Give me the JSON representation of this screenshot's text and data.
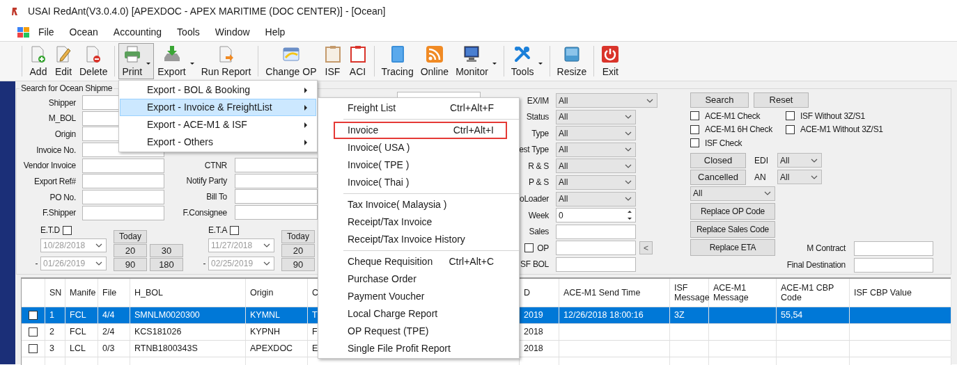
{
  "window": {
    "title": "USAI RedAnt(V3.0.4.0) [APEXDOC - APEX MARITIME (DOC CENTER)] - [Ocean]"
  },
  "menu_bar": [
    "File",
    "Ocean",
    "Accounting",
    "Tools",
    "Window",
    "Help"
  ],
  "toolbar": [
    [
      {
        "label": "Add",
        "dropdown": false,
        "pressed": false
      },
      {
        "label": "Edit",
        "dropdown": false,
        "pressed": false
      },
      {
        "label": "Delete",
        "dropdown": false,
        "pressed": false
      }
    ],
    [
      {
        "label": "Print",
        "dropdown": true,
        "pressed": true
      },
      {
        "label": "Export",
        "dropdown": true,
        "pressed": false
      },
      {
        "label": "Run Report",
        "dropdown": false,
        "pressed": false
      }
    ],
    [
      {
        "label": "Change OP",
        "dropdown": false,
        "pressed": false
      },
      {
        "label": "ISF",
        "dropdown": false,
        "pressed": false
      },
      {
        "label": "ACI",
        "dropdown": false,
        "pressed": false
      }
    ],
    [
      {
        "label": "Tracing",
        "dropdown": false,
        "pressed": false
      },
      {
        "label": "Online",
        "dropdown": false,
        "pressed": false
      },
      {
        "label": "Monitor",
        "dropdown": true,
        "pressed": false
      }
    ],
    [
      {
        "label": "Tools",
        "dropdown": true,
        "pressed": false
      }
    ],
    [
      {
        "label": "Resize",
        "dropdown": false,
        "pressed": false
      }
    ],
    [
      {
        "label": "Exit",
        "dropdown": false,
        "pressed": false
      }
    ]
  ],
  "search_panel": {
    "title": "Search for Ocean Shipme",
    "column_1": [
      "Shipper",
      "M_BOL",
      "Origin",
      "Invoice No.",
      "Vendor Invoice",
      "Export Ref#",
      "PO No.",
      "F.Shipper"
    ],
    "column_2": [
      "CTNR",
      "Notify Party",
      "Bill To",
      "F.Consignee"
    ],
    "etd": {
      "label": "E.T.D",
      "checked": false,
      "disabled": true,
      "from": "10/28/2018",
      "separator": "-",
      "to": "01/26/2019",
      "today_button": "Today",
      "range_buttons": [
        [
          "20",
          "30"
        ],
        [
          "90",
          "180"
        ]
      ]
    },
    "eta": {
      "label": "E.T.A",
      "checked": false,
      "disabled": true,
      "from": "11/27/2018",
      "separator": "-",
      "to": "02/25/2019",
      "today_button": "Today",
      "range_buttons": [
        [
          "20"
        ],
        [
          "90"
        ]
      ]
    },
    "column_3": [
      {
        "kind": "select",
        "label": "EX/IM",
        "value": "All"
      },
      {
        "kind": "select",
        "label": "Status",
        "value": "All"
      },
      {
        "kind": "select",
        "label": "Type",
        "value": "All"
      },
      {
        "kind": "select",
        "label": "est Type",
        "value": "All"
      },
      {
        "kind": "select",
        "label": "R & S",
        "value": "All"
      },
      {
        "kind": "select",
        "label": "P & S",
        "value": "All"
      },
      {
        "kind": "select",
        "label": "oLoader",
        "value": "All"
      },
      {
        "kind": "spinner",
        "label": "Week",
        "value": "0"
      },
      {
        "kind": "text",
        "label": "Sales"
      },
      {
        "kind": "check_text",
        "label": "OP",
        "checked": false,
        "button": "<"
      },
      {
        "kind": "text",
        "label": "SF BOL"
      }
    ],
    "search_button": "Search",
    "reset_button": "Reset",
    "checks": [
      {
        "label": "ACE-M1 Check",
        "checked": false
      },
      {
        "label": "ISF Without 3Z/S1",
        "checked": false
      },
      {
        "label": "ACE-M1 6H Check",
        "checked": false
      },
      {
        "label": "ACE-M1 Without 3Z/S1",
        "checked": false
      },
      {
        "label": "ISF Check",
        "checked": false
      }
    ],
    "status_rows": [
      {
        "button": "Closed",
        "label": "EDI",
        "value": "All"
      },
      {
        "button": "Cancelled",
        "label": "AN",
        "value": "All"
      }
    ],
    "filter_select": "All",
    "replace_buttons": [
      "Replace OP Code",
      "Replace Sales Code",
      "Replace ETA"
    ],
    "extra_fields": [
      "M Contract",
      "Final Destination"
    ]
  },
  "table": {
    "columns": [
      "SN",
      "Manife",
      "File",
      "H_BOL",
      "Origin",
      "C",
      "D",
      "ACE-M1 Send Time",
      "ISF Message",
      "ACE-M1 Message",
      "ACE-M1 CBP Code",
      "ISF CBP Value"
    ],
    "rows": [
      {
        "selected": true,
        "checked": false,
        "cells": [
          "1",
          "FCL",
          "4/4",
          "SMNLM0020300",
          "KYMNL",
          "T",
          "2019",
          "12/26/2018 18:00:16",
          "3Z",
          null,
          "55,54",
          null
        ]
      },
      {
        "selected": false,
        "checked": false,
        "cells": [
          "2",
          "FCL",
          "2/4",
          "KCS181026",
          "KYPNH",
          "F",
          "2018",
          null,
          null,
          null,
          null,
          null
        ]
      },
      {
        "selected": false,
        "checked": false,
        "cells": [
          "3",
          "LCL",
          "0/3",
          "RTNB1800343S",
          "APEXDOC",
          "E",
          "2018",
          null,
          null,
          null,
          null,
          null
        ]
      }
    ]
  },
  "print_menu": [
    {
      "label": "Export - BOL & Booking",
      "submenu": true,
      "selected": false
    },
    {
      "label": "Export - Invoice & FreightList",
      "submenu": true,
      "selected": true
    },
    {
      "label": "Export - ACE-M1 & ISF",
      "submenu": true,
      "selected": false
    },
    {
      "label": "Export - Others",
      "submenu": true,
      "selected": false
    }
  ],
  "invoice_submenu": [
    [
      {
        "label": "Freight List",
        "shortcut": "Ctrl+Alt+F",
        "outlined": false
      }
    ],
    [
      {
        "label": "Invoice",
        "shortcut": "Ctrl+Alt+I",
        "outlined": true
      },
      {
        "label": "Invoice( USA )",
        "outlined": false
      },
      {
        "label": "Invoice( TPE )",
        "outlined": false
      },
      {
        "label": "Invoice( Thai )",
        "outlined": false
      }
    ],
    [
      {
        "label": "Tax Invoice( Malaysia )",
        "outlined": false
      },
      {
        "label": "Receipt/Tax Invoice",
        "outlined": false
      },
      {
        "label": "Receipt/Tax Invoice History",
        "outlined": false
      }
    ],
    [
      {
        "label": "Cheque Requisition",
        "shortcut": "Ctrl+Alt+C",
        "outlined": false
      },
      {
        "label": "Purchase Order",
        "outlined": false
      },
      {
        "label": "Payment Voucher",
        "outlined": false
      },
      {
        "label": "Local Charge Report",
        "outlined": false
      },
      {
        "label": "OP Request (TPE)",
        "outlined": false
      },
      {
        "label": "Single File Profit Report",
        "outlined": false
      }
    ]
  ]
}
